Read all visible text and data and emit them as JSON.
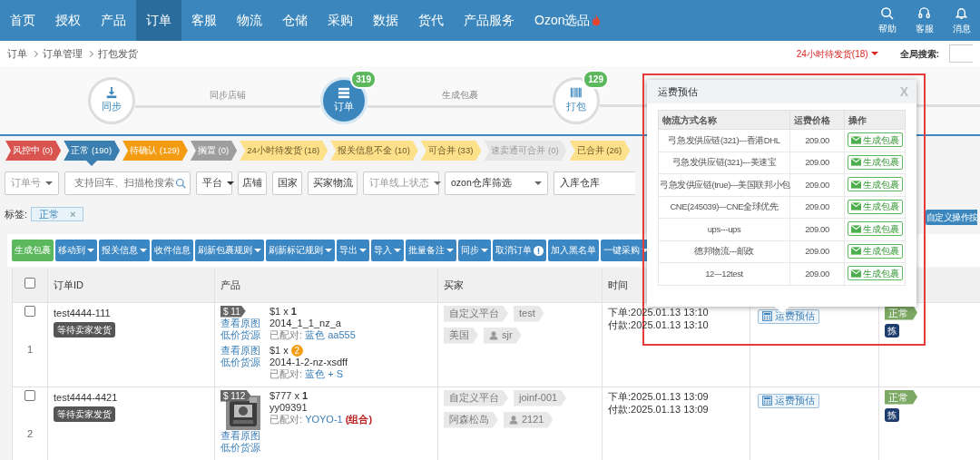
{
  "nav": {
    "items": [
      {
        "label": "首页",
        "selected": false,
        "hot": false
      },
      {
        "label": "授权",
        "selected": false,
        "hot": false
      },
      {
        "label": "产品",
        "selected": false,
        "hot": false
      },
      {
        "label": "订单",
        "selected": true,
        "hot": false
      },
      {
        "label": "客服",
        "selected": false,
        "hot": false
      },
      {
        "label": "物流",
        "selected": false,
        "hot": false
      },
      {
        "label": "仓储",
        "selected": false,
        "hot": false
      },
      {
        "label": "采购",
        "selected": false,
        "hot": false
      },
      {
        "label": "数据",
        "selected": false,
        "hot": false
      },
      {
        "label": "货代",
        "selected": false,
        "hot": false
      },
      {
        "label": "产品服务",
        "selected": false,
        "hot": false
      },
      {
        "label": "Ozon选品",
        "selected": false,
        "hot": true
      }
    ],
    "tools": [
      {
        "label": "帮助",
        "kind": "search"
      },
      {
        "label": "客服",
        "kind": "support"
      },
      {
        "label": "消息",
        "kind": "bell"
      }
    ]
  },
  "breadcrumb": [
    "订单",
    "订单管理",
    "打包发货"
  ],
  "urgent_link": "24小时待发货(18)",
  "global_search": {
    "label": "全局搜索:"
  },
  "steps": [
    {
      "label": "同步",
      "selected": false
    },
    {
      "label": "订单",
      "selected": true,
      "badge": "319"
    },
    {
      "label": "打包",
      "selected": false,
      "badge": "129"
    }
  ],
  "connectors": [
    "同步店铺",
    "生成包裹"
  ],
  "status_tags": [
    {
      "label": "风控中 (0)",
      "color": "#d9534f",
      "selected": false
    },
    {
      "label": "正常 (190)",
      "color": "#3a7fb0",
      "selected": true
    },
    {
      "label": "待确认 (129)",
      "color": "#f39c12",
      "selected": false
    },
    {
      "label": "搁置 (0)",
      "color": "#9e9e9e",
      "selected": false
    },
    {
      "label": "24小时待发货 (18)",
      "color": "#fde08a",
      "selected": false
    },
    {
      "label": "报关信息不全 (10)",
      "color": "#fde08a",
      "selected": false
    },
    {
      "label": "可合并 (33)",
      "color": "#fde08a",
      "selected": false
    },
    {
      "label": "速卖通可合并 (0)",
      "color": "#e6e6e6",
      "selected": false
    },
    {
      "label": "已合并 (26)",
      "color": "#fde08a",
      "selected": false
    }
  ],
  "filters": [
    {
      "kind": "select",
      "placeholder": "订单号"
    },
    {
      "kind": "search",
      "placeholder": "支持回车、扫描枪搜索"
    },
    {
      "kind": "dropdown",
      "value": "平台"
    },
    {
      "kind": "button",
      "value": "店铺"
    },
    {
      "kind": "button",
      "value": "国家"
    },
    {
      "kind": "button",
      "value": "买家物流"
    },
    {
      "kind": "select",
      "placeholder": "订单线上状态"
    },
    {
      "kind": "select",
      "value": "ozon仓库筛选"
    },
    {
      "kind": "input",
      "value": "入库仓库"
    }
  ],
  "tag_filter": {
    "label": "标签:",
    "tags": [
      {
        "label": "正常",
        "remove": "×"
      }
    ]
  },
  "side_button": "自定义操作按",
  "toolbar": [
    {
      "label": "生成包裹",
      "kind": "success",
      "dropdown": false,
      "alert": false
    },
    {
      "label": "移动到",
      "kind": "primary",
      "dropdown": true,
      "alert": false
    },
    {
      "label": "报关信息",
      "kind": "primary",
      "dropdown": true,
      "alert": false
    },
    {
      "label": "收件信息",
      "kind": "primary",
      "dropdown": false,
      "alert": false
    },
    {
      "label": "刷新包裹规则",
      "kind": "primary",
      "dropdown": true,
      "alert": false
    },
    {
      "label": "刷新标记规则",
      "kind": "primary",
      "dropdown": true,
      "alert": false
    },
    {
      "label": "导出",
      "kind": "primary",
      "dropdown": true,
      "alert": false
    },
    {
      "label": "导入",
      "kind": "primary",
      "dropdown": true,
      "alert": false
    },
    {
      "label": "批量备注",
      "kind": "primary",
      "dropdown": true,
      "alert": false
    },
    {
      "label": "同步",
      "kind": "primary",
      "dropdown": true,
      "alert": false
    },
    {
      "label": "取消订单",
      "kind": "primary",
      "dropdown": false,
      "alert": true
    },
    {
      "label": "加入黑名单",
      "kind": "primary",
      "dropdown": false,
      "alert": false
    },
    {
      "label": "一键采购",
      "kind": "primary",
      "dropdown": true,
      "alert": false
    }
  ],
  "table": {
    "select_all": {
      "checked": false
    },
    "columns": [
      "订单ID",
      "产品",
      "买家",
      "时间"
    ],
    "rows": [
      {
        "selected": false,
        "number": "1",
        "order_id": "test4444-111",
        "status": "等待卖家发货",
        "products": [
          {
            "price_tag": "$ 11",
            "links": [
              "查看原图",
              "低价货源"
            ],
            "price": "$1 x",
            "qty": "1",
            "qty_highlight": false,
            "sku": "2014_1_1_nz_a",
            "paired_label": "已配对:",
            "paired": "蓝色 aa555"
          },
          {
            "links": [
              "查看原图",
              "低价货源"
            ],
            "price": "$1 x",
            "qty": "2",
            "qty_highlight": true,
            "sku": "2014-1-2-nz-xsdff",
            "paired_label": "已配对:",
            "paired": "蓝色 + S"
          }
        ],
        "buyer": {
          "platform": "自定义平台",
          "shop": "test",
          "country": "美国",
          "user": "sjr"
        },
        "times": [
          "下单:2025.01.13 13:10",
          "付款:2025.01.13 13:10"
        ],
        "estimate_button": "运费预估",
        "state_tag": "正常",
        "pick_badge": "拣"
      },
      {
        "selected": false,
        "number": "2",
        "order_id": "test4444-4421",
        "status": "等待卖家发货",
        "products": [
          {
            "price_tag": "$ 112",
            "image": {
              "kind": "picture"
            },
            "links": [
              "查看原图",
              "低价货源"
            ],
            "price": "$777 x",
            "qty": "1",
            "qty_highlight": false,
            "sku": "yy09391",
            "paired_label": "已配对:",
            "paired": "YOYO-1",
            "paired_extra": "(组合)"
          }
        ],
        "buyer": {
          "platform": "自定义平台",
          "shop": "joinf-001",
          "country": "阿森松岛",
          "user": "2121"
        },
        "times": [
          "下单:2025.01.13 13:09",
          "付款:2025.01.13 13:09"
        ],
        "estimate_button": "运费预估",
        "state_tag": "正常",
        "pick_badge": "拣"
      }
    ]
  },
  "popup": {
    "title": "运费预估",
    "close": "X",
    "columns": [
      "物流方式名称",
      "运费价格",
      "操作"
    ],
    "rows": [
      {
        "name": "弓急发供应链(321)---香港DHL",
        "price": "209.00",
        "action": "生成包裹"
      },
      {
        "name": "弓急发供应链(321)---美速宝",
        "price": "209.00",
        "action": "生成包裹"
      },
      {
        "name": "弓急发供应链(true)---美国联邦小包",
        "price": "209.00",
        "action": "生成包裹"
      },
      {
        "name": "CNE(245039)---CNE全球优先",
        "price": "209.00",
        "action": "生成包裹"
      },
      {
        "name": "ups---ups",
        "price": "209.00",
        "action": "生成包裹"
      },
      {
        "name": "德邦物流---邮政",
        "price": "209.00",
        "action": "生成包裹"
      },
      {
        "name": "12---12test",
        "price": "209.00",
        "action": "生成包裹"
      }
    ]
  },
  "highlight": {
    "kind": "frame"
  }
}
